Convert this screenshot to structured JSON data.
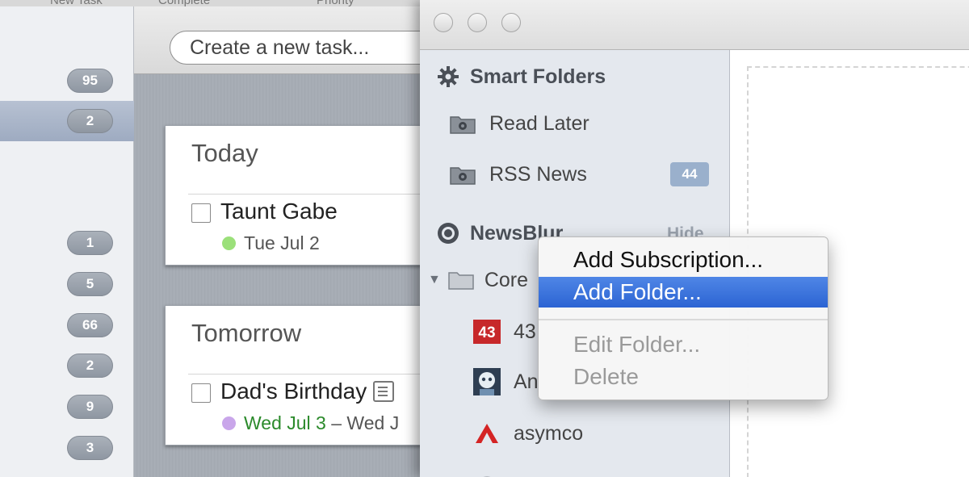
{
  "task_app": {
    "new_task_placeholder": "Create a new task...",
    "top_labels": [
      "New Task",
      "Complete",
      "Priority"
    ],
    "sidebar_counts": [
      "95",
      "2",
      "1",
      "5",
      "66",
      "2",
      "9",
      "3"
    ],
    "days": [
      {
        "title": "Today",
        "tasks": [
          {
            "name": "Taunt Gabe",
            "date": "Tue Jul 2",
            "dot_color": "#9be07a"
          }
        ]
      },
      {
        "title": "Tomorrow",
        "tasks": [
          {
            "name": "Dad's Birthday",
            "date_start": "Wed Jul 3",
            "date_separator": " – Wed J",
            "dot_color": "#c9a6ea",
            "has_note": true
          }
        ]
      }
    ]
  },
  "reader": {
    "smart_folders": {
      "title": "Smart Folders",
      "items": [
        {
          "label": "Read Later",
          "icon": "smart-folder-icon"
        },
        {
          "label": "RSS News",
          "icon": "smart-folder-icon",
          "badge": "44"
        }
      ]
    },
    "newsblur": {
      "title": "NewsBlur",
      "hide_label": "Hide",
      "folder_label": "Core",
      "feeds": [
        {
          "label": "43",
          "icon": "43folders-icon"
        },
        {
          "label": "An",
          "icon": "avatar-icon"
        },
        {
          "label": "asymco",
          "icon": "asymco-icon"
        }
      ]
    }
  },
  "context_menu": {
    "items": [
      {
        "label": "Add Subscription...",
        "state": "normal"
      },
      {
        "label": "Add Folder...",
        "state": "selected"
      },
      {
        "label": "Edit Folder...",
        "state": "disabled"
      },
      {
        "label": "Delete",
        "state": "disabled"
      }
    ]
  },
  "colors": {
    "menu_highlight": "#3b73dc",
    "badge": "#9ab0cc",
    "today_dot": "#9be07a",
    "birthday_dot": "#c9a6ea",
    "due_green": "#2b8a2b"
  }
}
